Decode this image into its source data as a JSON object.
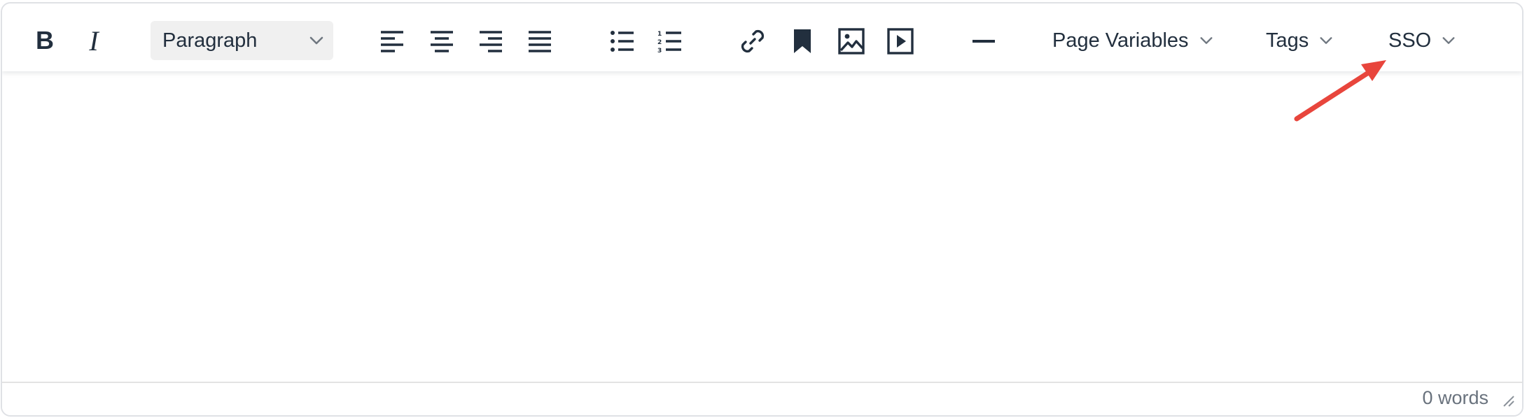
{
  "toolbar": {
    "bold_label": "B",
    "italic_label": "I",
    "block_format": "Paragraph",
    "menus": {
      "page_variables": "Page Variables",
      "tags": "Tags",
      "sso": "SSO"
    }
  },
  "icons": {
    "align_left": "align-left-icon",
    "align_center": "align-center-icon",
    "align_right": "align-right-icon",
    "align_justify": "align-justify-icon",
    "bullet_list": "bullet-list-icon",
    "numbered_list": "numbered-list-icon",
    "link": "link-icon",
    "bookmark": "bookmark-icon",
    "image": "image-icon",
    "media": "media-icon",
    "horizontal_rule": "horizontal-rule-icon"
  },
  "statusbar": {
    "word_count": "0 words"
  },
  "colors": {
    "icon": "#222f3e",
    "annotation_arrow": "#e8453c",
    "border": "#dfe1e5",
    "select_bg": "#f0f0f0",
    "status_text": "#69727d"
  }
}
